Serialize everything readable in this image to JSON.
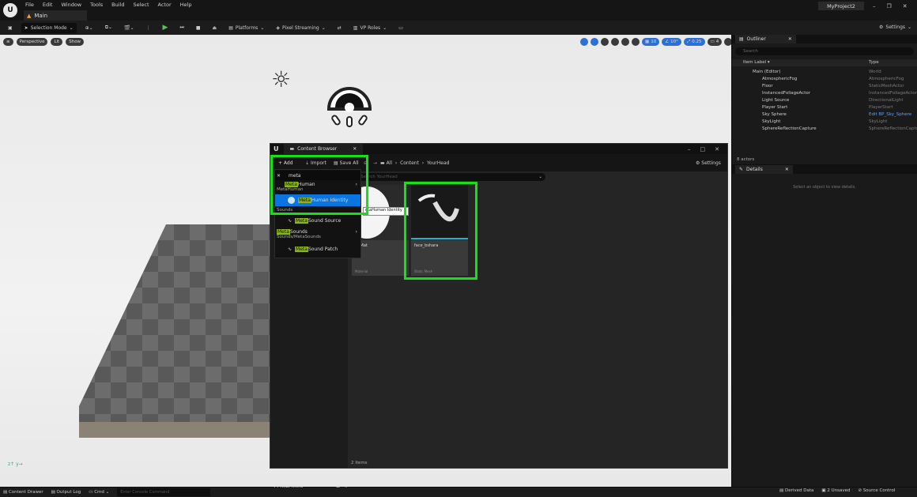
{
  "menu": [
    "File",
    "Edit",
    "Window",
    "Tools",
    "Build",
    "Select",
    "Actor",
    "Help"
  ],
  "app": {
    "logo": "U",
    "tab": "Main",
    "project": "MyProject2"
  },
  "toolbar": {
    "selection_mode": "Selection Mode",
    "platforms": "Platforms",
    "pixel_streaming": "Pixel Streaming",
    "vp_roles": "VP Roles",
    "settings": "Settings"
  },
  "viewport": {
    "perspective": "Perspective",
    "lit": "Lit",
    "show": "Show",
    "grid_snap": "10",
    "rot_snap": "10°",
    "scale_snap": "0.25",
    "cam_speed": "4"
  },
  "outliner": {
    "tab": "Outliner",
    "search_placeholder": "Search",
    "col_label": "Item Label ▾",
    "col_type": "Type",
    "rows": [
      {
        "label": "Main (Editor)",
        "type": "World"
      },
      {
        "label": "AtmosphericFog",
        "type": "AtmosphericFog"
      },
      {
        "label": "Floor",
        "type": "StaticMeshActor"
      },
      {
        "label": "InstancedFoliageActor",
        "type": "InstancedFoliageActor"
      },
      {
        "label": "Light Source",
        "type": "DirectionalLight"
      },
      {
        "label": "Player Start",
        "type": "PlayerStart"
      },
      {
        "label": "Sky Sphere",
        "type": "Edit BP_Sky_Sphere"
      },
      {
        "label": "SkyLight",
        "type": "SkyLight"
      },
      {
        "label": "SphereReflectionCapture",
        "type": "SphereReflectionCapture"
      }
    ],
    "count": "8 actors"
  },
  "details": {
    "tab": "Details",
    "empty_msg": "Select an object to view details."
  },
  "content_browser": {
    "title": "Content Browser",
    "add": "+ Add",
    "import": "Import",
    "save_all": "Save All",
    "crumbs": [
      "All",
      "Content",
      "YourHead"
    ],
    "settings": "Settings",
    "search_placeholder": "Search YourHead",
    "filter_text": "meta",
    "tiles": [
      {
        "overlay": "etaHuman Identity",
        "name": "ultMat",
        "kind": "Material"
      },
      {
        "name": "face_bshara",
        "kind": "Static Mesh"
      }
    ],
    "collections": "Collections",
    "items_count": "2 items"
  },
  "dropdown": {
    "rows": [
      {
        "hl": "Meta",
        "rest": "Human"
      },
      {
        "category": "MetaHuman"
      },
      {
        "hl": "Meta",
        "rest": "Human Identity"
      },
      {
        "category": "Sounds"
      },
      {
        "hl": "Meta",
        "rest": "Sound Source"
      },
      {
        "hl": "Meta",
        "rest": "Sounds"
      },
      {
        "category": "Sounds/MetaSounds"
      },
      {
        "hl": "Meta",
        "rest": "Sound Patch"
      }
    ]
  },
  "statusbar": {
    "content_drawer": "Content Drawer",
    "output_log": "Output Log",
    "cmd": "Cmd",
    "console_placeholder": "Enter Console Command",
    "derived_data": "Derived Data",
    "unsaved": "2 Unsaved",
    "source_control": "Source Control"
  },
  "colors": {
    "accent_blue": "#0a74e0",
    "highlight_yellow": "#8bb61a",
    "annotation_green": "#17e017",
    "play_green": "#55c355"
  }
}
